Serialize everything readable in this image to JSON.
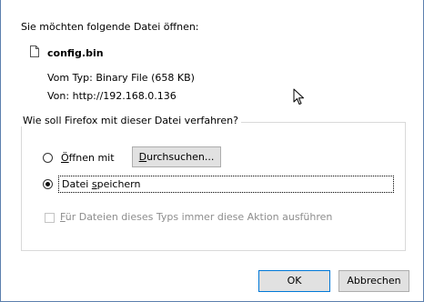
{
  "dialog": {
    "prompt": "Sie möchten folgende Datei öffnen:",
    "file": {
      "name": "config.bin",
      "type_label": "Vom Typ:",
      "type_value": "Binary File (658 KB)",
      "from_label": "Von:",
      "from_value": "http://192.168.0.136",
      "icon": "file-icon"
    },
    "action_group": {
      "legend": "Wie soll Firefox mit dieser Datei verfahren?",
      "open_with": {
        "mnemonic": "Ö",
        "label_rest": "ffnen mit",
        "selected": false
      },
      "browse_button": {
        "mnemonic": "D",
        "label_rest": "urchsuchen..."
      },
      "save_file": {
        "label_pre": "Datei ",
        "mnemonic": "s",
        "label_rest": "peichern",
        "selected": true
      },
      "always_checkbox": {
        "mnemonic": "F",
        "label_rest": "ür Dateien dieses Typs immer diese Aktion ausführen",
        "checked": false,
        "disabled": true
      }
    },
    "buttons": {
      "ok": "OK",
      "cancel": "Abbrechen"
    }
  },
  "colors": {
    "frame_border": "#5b7fae",
    "button_bg": "#e1e1e1",
    "default_button_border": "#0078d7",
    "disabled_text": "#8d8d8d"
  }
}
